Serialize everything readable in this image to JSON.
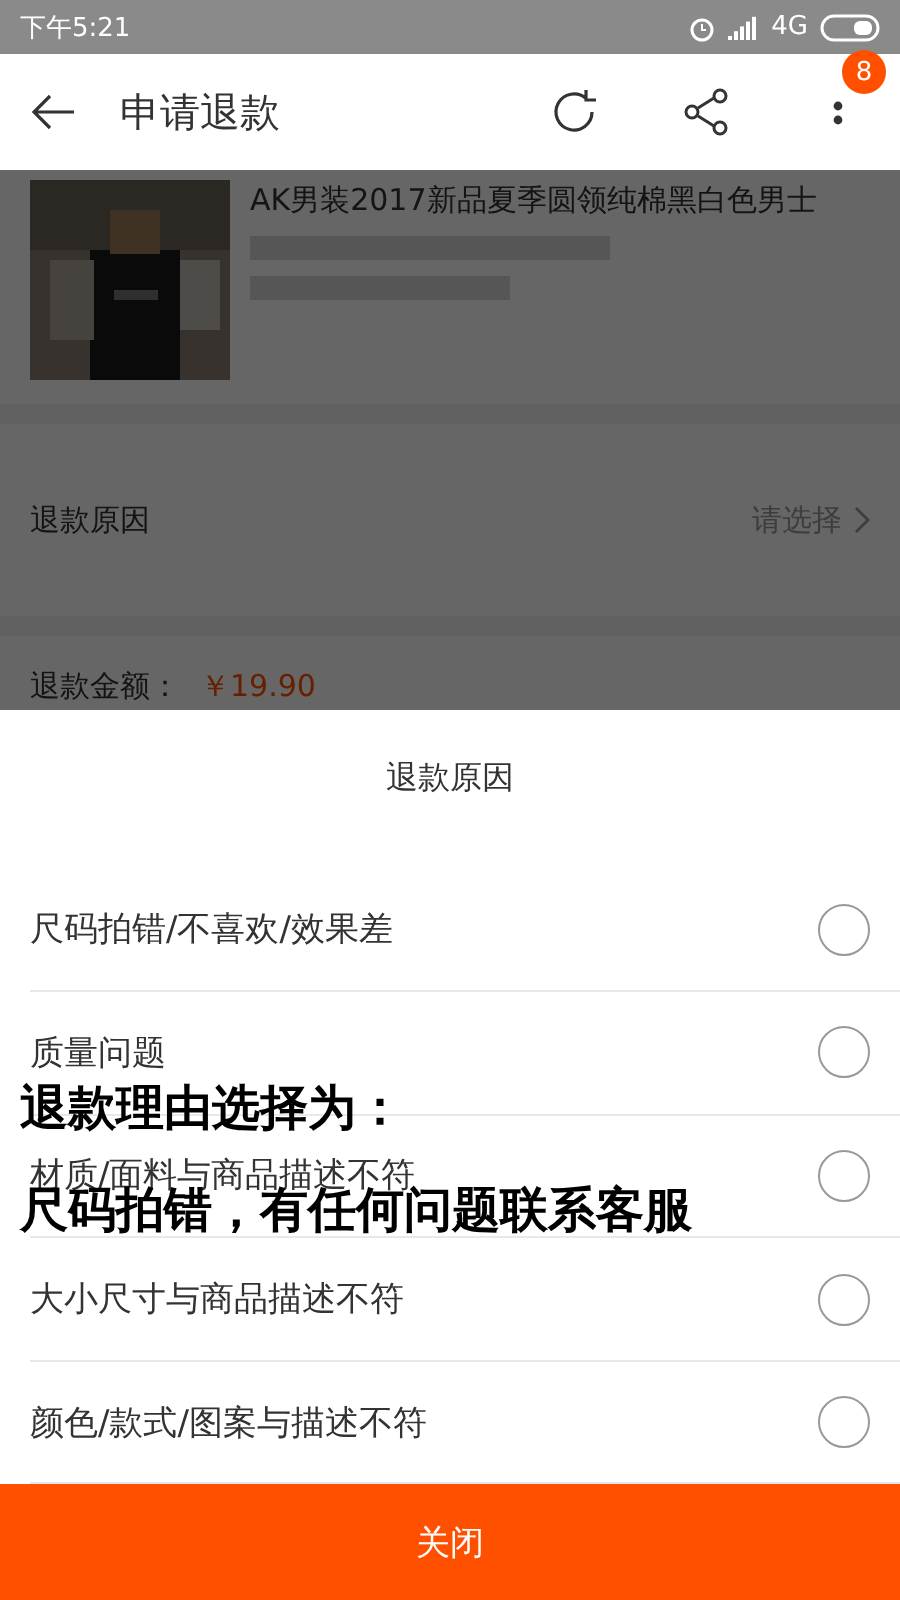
{
  "status_bar": {
    "time": "下午5:21",
    "network": "4G"
  },
  "header": {
    "title": "申请退款",
    "badge": "8"
  },
  "product": {
    "title": "AK男装2017新品夏季圆领纯棉黑白色男士"
  },
  "reason_row": {
    "label": "退款原因",
    "value": "请选择"
  },
  "amount_row": {
    "label": "退款金额：",
    "value": "￥19.90"
  },
  "sheet": {
    "title": "退款原因",
    "options": [
      {
        "label": "尺码拍错/不喜欢/效果差",
        "selected": false
      },
      {
        "label": "质量问题",
        "selected": false
      },
      {
        "label": "材质/面料与商品描述不符",
        "selected": false
      },
      {
        "label": "大小尺寸与商品描述不符",
        "selected": false
      },
      {
        "label": "颜色/款式/图案与描述不符",
        "selected": false
      }
    ],
    "close_button": "关闭"
  },
  "caption": [
    "退款理由选择为：",
    "尺码拍错，有任何问题联系客服"
  ]
}
